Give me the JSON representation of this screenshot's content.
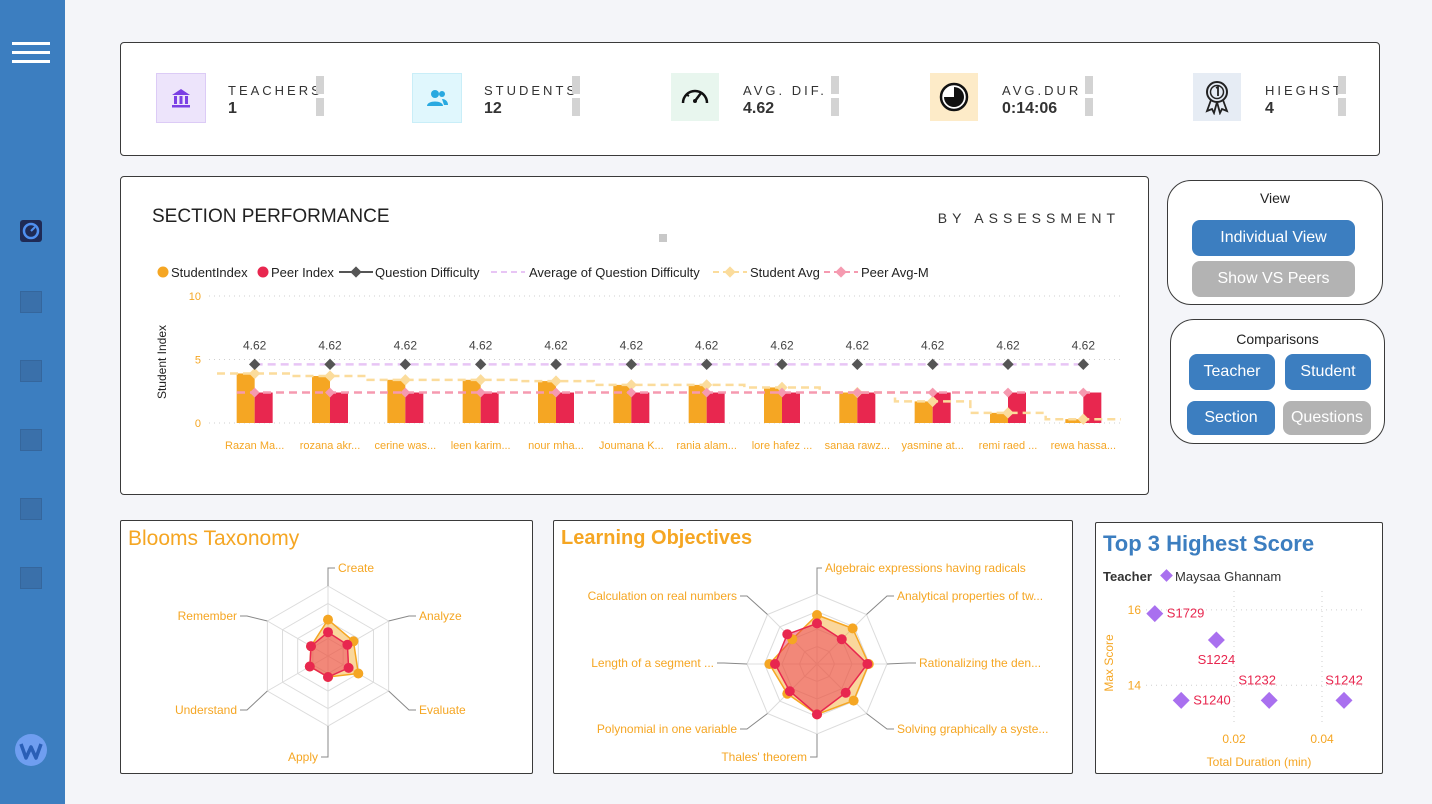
{
  "sidebar": {
    "menu_icon": "hamburger-icon",
    "items": [
      "gauge-icon",
      "nav-item",
      "nav-item",
      "nav-item",
      "nav-item",
      "nav-item"
    ],
    "logo_icon": "logo-icon"
  },
  "kpis": [
    {
      "label": "TEACHERS",
      "value": "1",
      "icon": "bank-icon",
      "color": "#7b3fe4",
      "bg": "#ede4fb"
    },
    {
      "label": "STUDENTS",
      "value": "12",
      "icon": "users-icon",
      "color": "#29a9e0",
      "bg": "#e0f7fd"
    },
    {
      "label": "AVG. DIF.",
      "value": "4.62",
      "icon": "speedometer-icon",
      "color": "#222222",
      "bg": "#e8f6ee"
    },
    {
      "label": "AVG.DUR",
      "value": "0:14:06",
      "icon": "clock-icon",
      "color": "#222222",
      "bg": "#fdebc8"
    },
    {
      "label": "HIEGHST",
      "value": "4",
      "icon": "award-icon",
      "color": "#333333",
      "bg": "#e6ecf4"
    }
  ],
  "section": {
    "title": "SECTION PERFORMANCE",
    "subtitle": "BY ASSESSMENT",
    "legend": [
      "StudentIndex",
      "Peer Index",
      "Question Difficulty",
      "Average of Question Difficulty",
      "Student Avg",
      "Peer Avg-M"
    ]
  },
  "view_panel": {
    "title": "View",
    "buttons": [
      "Individual View",
      "Show VS Peers"
    ]
  },
  "comparisons_panel": {
    "title": "Comparisons",
    "buttons": [
      "Teacher",
      "Student",
      "Section",
      "Questions"
    ]
  },
  "blooms": {
    "title": "Blooms Taxonomy"
  },
  "objectives": {
    "title": "Learning Objectives"
  },
  "top3": {
    "title": "Top 3 Highest Score",
    "legend_label": "Teacher",
    "legend_item": "Maysaa Ghannam"
  },
  "chart_data": [
    {
      "type": "bar",
      "ylabel": "Student Index",
      "ylim": [
        0,
        10
      ],
      "yticks": [
        0,
        5,
        10
      ],
      "categories": [
        "Razan Ma...",
        "rozana akr...",
        "cerine was...",
        "leen karim...",
        "nour mha...",
        "Joumana K...",
        "rania alam...",
        "lore hafez ...",
        "sanaa rawz...",
        "yasmine at...",
        "remi raed ...",
        "rewa hassa..."
      ],
      "series": [
        {
          "name": "StudentIndex",
          "color": "#f5a623",
          "values": [
            3.9,
            3.7,
            3.4,
            3.4,
            3.3,
            3.0,
            3.0,
            2.8,
            2.4,
            1.7,
            0.8,
            0.3
          ]
        },
        {
          "name": "Peer Index",
          "color": "#e8274f",
          "values": [
            2.4,
            2.4,
            2.4,
            2.4,
            2.4,
            2.4,
            2.4,
            2.4,
            2.4,
            2.4,
            2.4,
            2.4
          ]
        },
        {
          "name": "Question Difficulty",
          "color": "#555555",
          "values": [
            4.62,
            4.62,
            4.62,
            4.62,
            4.62,
            4.62,
            4.62,
            4.62,
            4.62,
            4.62,
            4.62,
            4.62
          ]
        },
        {
          "name": "Average of Question Difficulty",
          "color": "#e8c5f5",
          "values": [
            4.62,
            4.62,
            4.62,
            4.62,
            4.62,
            4.62,
            4.62,
            4.62,
            4.62,
            4.62,
            4.62,
            4.62
          ]
        },
        {
          "name": "Student Avg",
          "color": "#fbdc9c",
          "values": [
            3.9,
            3.7,
            3.4,
            3.4,
            3.3,
            3.0,
            3.0,
            2.8,
            2.4,
            1.7,
            0.8,
            0.3
          ]
        },
        {
          "name": "Peer Avg-M",
          "color": "#f59ab0",
          "values": [
            2.4,
            2.4,
            2.4,
            2.4,
            2.4,
            2.4,
            2.4,
            2.4,
            2.4,
            2.4,
            2.4,
            2.4
          ]
        }
      ],
      "data_labels": [
        "4.62",
        "4.62",
        "4.62",
        "4.62",
        "4.62",
        "4.62",
        "4.62",
        "4.62",
        "4.62",
        "4.62",
        "4.62",
        "4.62"
      ]
    },
    {
      "type": "radar",
      "axes": [
        "Create",
        "Analyze",
        "Evaluate",
        "Apply",
        "Understand",
        "Remember"
      ],
      "rmax": 1,
      "series": [
        {
          "name": "orange",
          "color": "#f5a623",
          "values": [
            0.52,
            0.42,
            0.5,
            0.3,
            0.3,
            0.28
          ]
        },
        {
          "name": "red",
          "color": "#e8274f",
          "values": [
            0.34,
            0.32,
            0.34,
            0.3,
            0.3,
            0.28
          ]
        }
      ]
    },
    {
      "type": "radar",
      "axes": [
        "Algebraic expressions having radicals",
        "Analytical properties of tw...",
        "Rationalizing the den...",
        "Solving graphically a syste...",
        "Thales' theorem",
        "Polynomial in one variable",
        "Length of a segment ...",
        "Calculation on real numbers"
      ],
      "rmax": 1,
      "series": [
        {
          "name": "orange",
          "color": "#f5a623",
          "values": [
            0.7,
            0.72,
            0.74,
            0.74,
            0.72,
            0.6,
            0.68,
            0.5
          ]
        },
        {
          "name": "red",
          "color": "#e8274f",
          "values": [
            0.58,
            0.5,
            0.72,
            0.58,
            0.72,
            0.55,
            0.6,
            0.6
          ]
        }
      ]
    },
    {
      "type": "scatter",
      "xlabel": "Total Duration (min)",
      "ylabel": "Max Score",
      "xlim": [
        0,
        0.05
      ],
      "ylim": [
        13,
        16.5
      ],
      "xticks": [
        "0.02",
        "0.04"
      ],
      "yticks": [
        "14",
        "16"
      ],
      "points": [
        {
          "label": "S1729",
          "x": 0.002,
          "y": 15.9
        },
        {
          "label": "S1224",
          "x": 0.016,
          "y": 15.2
        },
        {
          "label": "S1240",
          "x": 0.008,
          "y": 13.6
        },
        {
          "label": "S1232",
          "x": 0.028,
          "y": 13.6
        },
        {
          "label": "S1242",
          "x": 0.045,
          "y": 13.6
        }
      ]
    }
  ]
}
